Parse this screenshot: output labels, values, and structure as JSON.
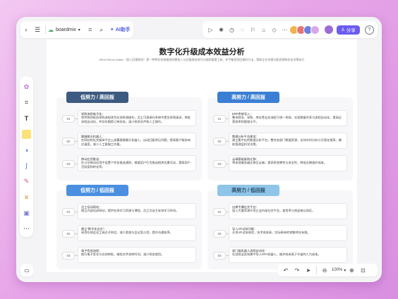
{
  "toolbar": {
    "brand": "boardmix",
    "ai_label": "AI助手",
    "share_label": "分享"
  },
  "doc": {
    "title": "数字化升级成本效益分析",
    "subtitle": "Effort Return Matrix（投入回报矩阵）是一种将任务依据其所需投入与回报高低进行分类的管理工具，并平衡投资回报的方法，帮助企业合理分配资源和优化决策执行"
  },
  "quadrants": [
    {
      "label": "低努力 / 高回报",
      "color": "#3d5a80",
      "items": [
        {
          "num": "01",
          "heading": "采购流程电子化：",
          "text": "将传统的纸质采购流程改为在线系统操作，员工可直接在系统中提交采购请求，审批流程自动化，并实时跟踪订单状态，减少纸质文件和人工操作。"
        },
        {
          "num": "02",
          "heading": "客服聊天机器人：",
          "text": "在网站和社交媒体平台上部署客服聊天机器人，自动回复常见问题，提高客户服务响应速度，减少人工客服工作量。"
        },
        {
          "num": "03",
          "heading": "移动应用推送：",
          "text": "在公司移动应用中设置个性化推送通知，根据用户行为推送相关优惠活动，提高用户活跃度和转化率。"
        }
      ]
    },
    {
      "label": "高努力 / 高回报",
      "color": "#3b7fd4",
      "items": [
        {
          "num": "01",
          "heading": "ERP系统导入：",
          "text": "整合财务、采购、库存等业务流程于统一系统，实现数据共享与流程自动化，提高运营效率和管理水平。"
        },
        {
          "num": "02",
          "heading": "数据分析平台建设：",
          "text": "建立集中化的数据分析平台，整合各部门数据资源，支持实时分析与可视化报表，辅助管理层科学决策。"
        },
        {
          "num": "03",
          "heading": "云端基础架构迁移：",
          "text": "将本地服务器迁移至云端，提高系统弹性与安全性，降低长期维护成本。"
        }
      ]
    },
    {
      "label": "低努力 / 低回报",
      "color": "#4a8fe0",
      "items": [
        {
          "num": "01",
          "heading": "员工培训网站：",
          "text": "建立内部培训网站，提供在线学习资源与课程，员工可自主安排学习时间。"
        },
        {
          "num": "02",
          "heading": "建立“数字化会议”：",
          "text": "采用在线会议工具召开例会，减少差旅与会议室占用，提升沟通效率。"
        },
        {
          "num": "03",
          "heading": "电子签核流程：",
          "text": "推行电子签名与在线审批，缩短文件流转时间，减少纸张使用。"
        }
      ]
    },
    {
      "label": "高努力 / 低回报",
      "color": "#8ec5e8",
      "items": [
        {
          "num": "01",
          "heading": "自建专属社交平台：",
          "text": "投入大量资源开发企业内部社交平台，使用率与效益难以保证。"
        },
        {
          "num": "02",
          "heading": "导入AR试穿功能：",
          "text": "开发AR试穿体验，技术成本高，实际带来的销售转化有限。"
        },
        {
          "num": "03",
          "heading": "部门级机器人流程自动化：",
          "text": "在低频业务场景中导入RPA机器人，维护成本高于节省的人力成本。"
        }
      ]
    }
  ],
  "bottom": {
    "zoom": "100%"
  }
}
